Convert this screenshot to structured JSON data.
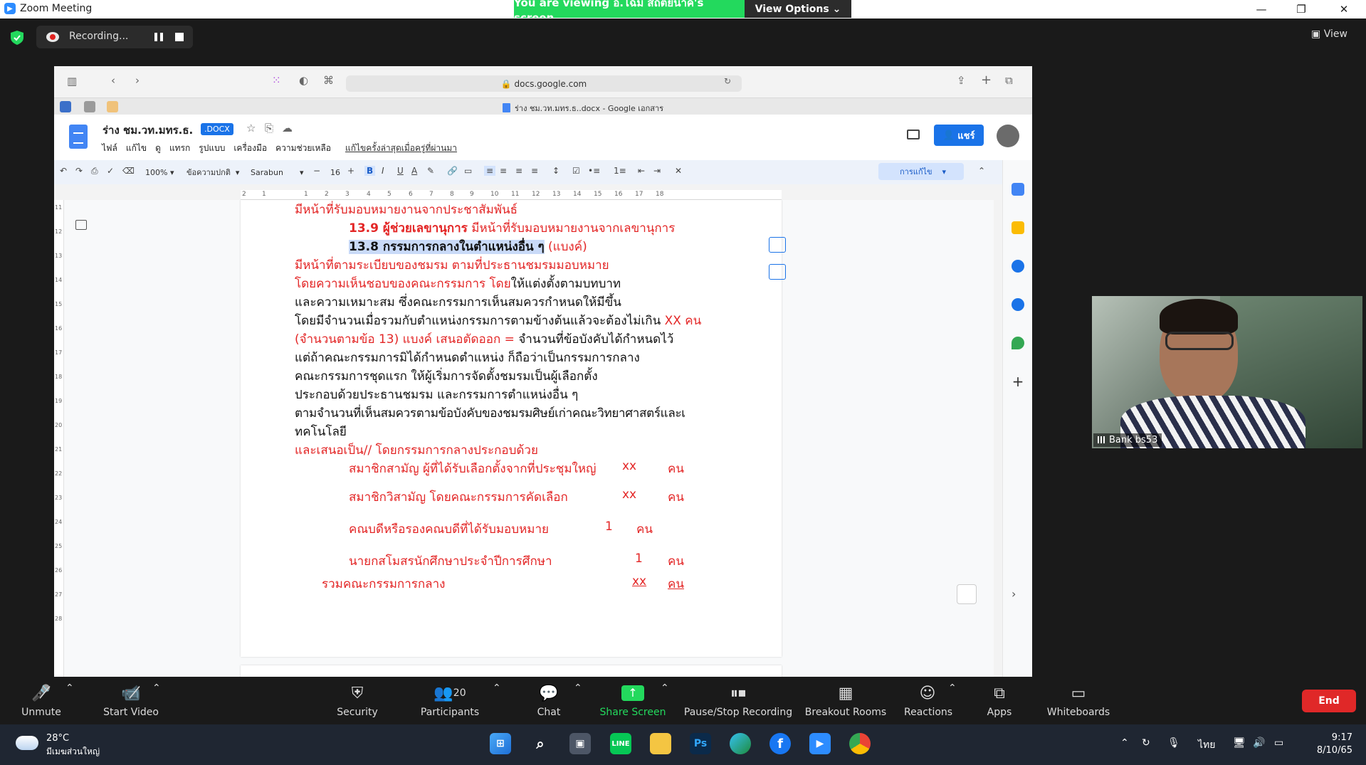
{
  "window": {
    "title": "Zoom Meeting",
    "viewing_banner": "You are viewing อ.โฉม สถิตยนาค's screen",
    "view_options": "View Options",
    "view_button": "View"
  },
  "recording": {
    "label": "Recording..."
  },
  "browser": {
    "url": "docs.google.com",
    "tab_title": "ร่าง ชม.วท.มทร.ธ..docx - Google เอกสาร"
  },
  "docs": {
    "title": "ร่าง ชม.วท.มทร.ธ.",
    "badge": ".DOCX",
    "menu": [
      "ไฟล์",
      "แก้ไข",
      "ดู",
      "แทรก",
      "รูปแบบ",
      "เครื่องมือ",
      "ความช่วยเหลือ"
    ],
    "last_edit": "แก้ไขครั้งล่าสุดเมื่อครู่ที่ผ่านมา",
    "share": "แชร์",
    "toolbar": {
      "zoom": "100%",
      "style": "ข้อความปกติ",
      "font": "Sarabun",
      "size": "16",
      "mode": "การแก้ไข"
    },
    "ruler": [
      "2",
      "1",
      "1",
      "2",
      "3",
      "4",
      "5",
      "6",
      "7",
      "8",
      "9",
      "10",
      "11",
      "12",
      "13",
      "14",
      "15",
      "16",
      "17",
      "18"
    ],
    "vruler": [
      "11",
      "12",
      "13",
      "14",
      "15",
      "16",
      "17",
      "18",
      "19",
      "20",
      "21",
      "22",
      "23",
      "24",
      "25",
      "26",
      "27",
      "28"
    ],
    "lines": {
      "l1": "มีหน้าที่รับมอบหมายงานจากประชาสัมพันธ์",
      "l2": "13.9 ผู้ช่วยเลขานุการ",
      "l2b": " มีหน้าที่รับมอบหมายงานจากเลขานุการ",
      "l3": "13.8 กรรมการกลางในตำแหน่งอื่น ๆ",
      "l3b": " (แบงค์)",
      "l4": "มีหน้าที่ตามระเบียบของชมรม ตามที่ประธานชมรมมอบหมาย",
      "l5a": "โดยความเห็นชอบของคณะกรรมการ โดย",
      "l5b": "ให้แต่งตั้งตามบทบาท",
      "l6": "และความเหมาะสม ซึ่งคณะกรรมการเห็นสมควรกำหนดให้มีขึ้น",
      "l7a": "โดยมีจำนวนเมื่อรวมกับตำแหน่งกรรมการตามข้างต้นแล้วจะต้องไม่เกิน",
      "l7b": " XX คน",
      "l8a": "(จำนวนตามข้อ 13)  แบงค์ เสนอตัดออก = ",
      "l8b": "จำนวนที่ข้อบังคับได้กำหนดไว้",
      "l9": "แต่ถ้าคณะกรรมการมิได้กำหนดตำแหน่ง ก็ถือว่าเป็นกรรมการกลาง",
      "l10": "คณะกรรมการชุดแรก ให้ผู้เริ่มการจัดตั้งชมรมเป็นผู้เลือกตั้ง",
      "l11": "ประกอบด้วยประธานชมรม และกรรมการตำแหน่งอื่น ๆ",
      "l12": "ตามจำนวนที่เห็นสมควรตามข้อบังคับของชมรมศิษย์เก่าคณะวิทยาศาสตร์และเ",
      "l13": "ทคโนโลยี",
      "l14": "และเสนอเป็น// โดยกรรมการกลางประกอบด้วย",
      "r1": "สมาชิกสามัญ ผู้ที่ได้รับเลือกตั้งจากที่ประชุมใหญ่",
      "r2": "สมาชิกวิสามัญ โดยคณะกรรมการคัดเลือก",
      "r3": "คณบดีหรือรองคณบดีที่ได้รับมอบหมาย",
      "r4": "นายกสโมสรนักศึกษาประจำปีการศึกษา",
      "r5": "รวมคณะกรรมการกลาง",
      "xx": "xx",
      "one": "1",
      "unit": "คน"
    }
  },
  "participant": {
    "name": "Bank bs53"
  },
  "zoom_toolbar": {
    "unmute": "Unmute",
    "start_video": "Start Video",
    "security": "Security",
    "participants": "Participants",
    "participants_count": "20",
    "chat": "Chat",
    "share_screen": "Share Screen",
    "pause_recording": "Pause/Stop Recording",
    "breakout": "Breakout Rooms",
    "reactions": "Reactions",
    "apps": "Apps",
    "whiteboards": "Whiteboards",
    "end": "End"
  },
  "taskbar": {
    "temp": "28°C",
    "weather": "มีเมฆส่วนใหญ่",
    "lang": "ไทย",
    "time": "9:17",
    "date": "8/10/65"
  },
  "colors": {
    "zoom_green": "#23d95d",
    "docs_blue": "#1a73e8",
    "doc_red": "#e32626",
    "end_red": "#e02828"
  }
}
